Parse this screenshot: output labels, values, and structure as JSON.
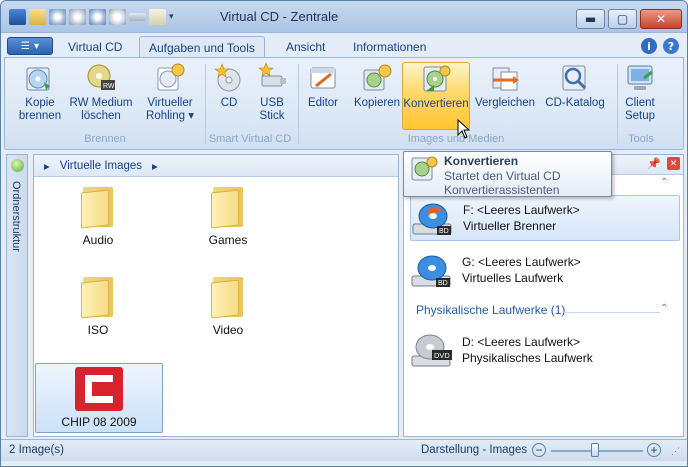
{
  "window": {
    "title": "Virtual CD - Zentrale"
  },
  "ribbon_tabs": [
    {
      "label": "Virtual CD",
      "active": false
    },
    {
      "label": "Aufgaben und Tools",
      "active": true
    },
    {
      "label": "Ansicht",
      "active": false
    },
    {
      "label": "Informationen",
      "active": false
    }
  ],
  "ribbon": {
    "buttons": [
      {
        "line1": "Kopie",
        "line2": "brennen",
        "icon": "disc-copy-icon"
      },
      {
        "line1": "RW Medium",
        "line2": "löschen",
        "icon": "rw-disc-icon"
      },
      {
        "line1": "Virtueller",
        "line2": "Rohling ▾",
        "icon": "blank-disc-icon"
      },
      {
        "line1": "CD",
        "line2": "",
        "icon": "cd-star-icon"
      },
      {
        "line1": "USB",
        "line2": "Stick",
        "icon": "usb-star-icon"
      },
      {
        "line1": "Editor",
        "line2": "",
        "icon": "editor-icon"
      },
      {
        "line1": "Kopieren",
        "line2": "",
        "icon": "copy-image-icon"
      },
      {
        "line1": "Konvertieren",
        "line2": "",
        "icon": "convert-icon"
      },
      {
        "line1": "Vergleichen",
        "line2": "",
        "icon": "compare-icon"
      },
      {
        "line1": "CD-Katalog",
        "line2": "",
        "icon": "catalog-icon"
      },
      {
        "line1": "Client",
        "line2": "Setup",
        "icon": "client-setup-icon"
      }
    ],
    "groups": [
      "Brennen",
      "Smart Virtual CD",
      "Images und Medien",
      "Tools"
    ]
  },
  "sidebar": {
    "label": "Ordnerstruktur"
  },
  "browser": {
    "breadcrumb": "Virtuelle Images",
    "items": [
      {
        "label": "Audio"
      },
      {
        "label": "Games"
      },
      {
        "label": "ISO"
      },
      {
        "label": "Video"
      },
      {
        "label": "CHIP 08 2009"
      }
    ]
  },
  "drives": {
    "virtual": [
      {
        "line1": "F: <Leeres Laufwerk>",
        "line2": "Virtueller Brenner",
        "badge": "BD"
      },
      {
        "line1": "G: <Leeres Laufwerk>",
        "line2": "Virtuelles Laufwerk",
        "badge": "BD"
      }
    ],
    "physical_header": "Physikalische Laufwerke (1)",
    "physical": [
      {
        "line1": "D: <Leeres Laufwerk>",
        "line2": "Physikalisches Laufwerk",
        "badge": "DVD"
      }
    ]
  },
  "tooltip": {
    "title": "Konvertieren",
    "line1": "Startet den Virtual CD",
    "line2": "Konvertierassistenten"
  },
  "status": {
    "count": "2 Image(s)",
    "view": "Darstellung - Images",
    "zoom": 0.48
  },
  "colors": {
    "accent": "#15428b",
    "highlight": "#ffd86a"
  }
}
